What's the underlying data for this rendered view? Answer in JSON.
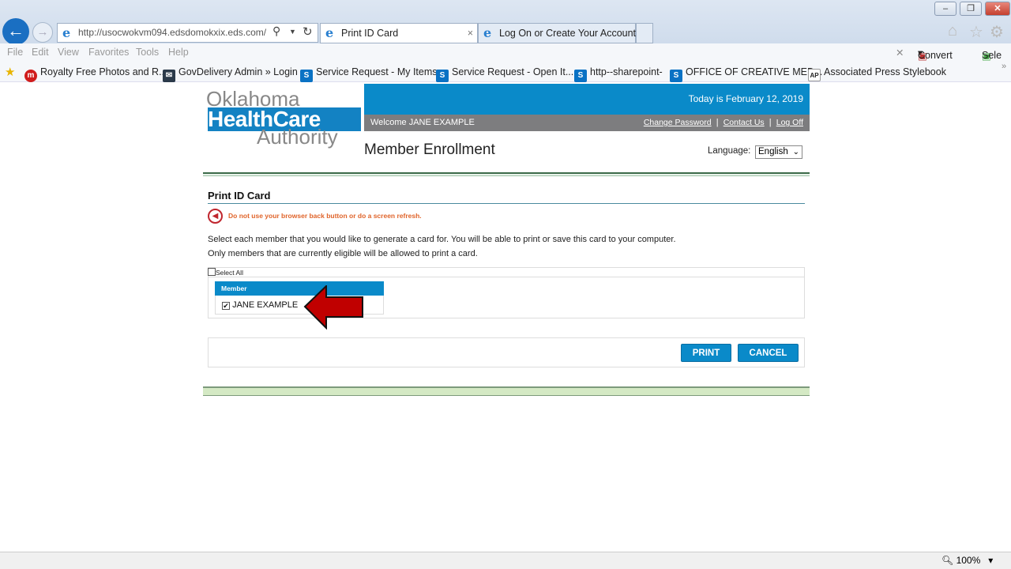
{
  "browser": {
    "address": "http://usocwokvm094.edsdomokxix.eds.com/",
    "tabs": [
      {
        "label": "Print ID Card",
        "active": true
      },
      {
        "label": "Log On or Create Your Account",
        "active": false
      }
    ],
    "menu": [
      "File",
      "Edit",
      "View",
      "Favorites",
      "Tools",
      "Help"
    ],
    "favorites": [
      "Royalty Free Photos and R...",
      "GovDelivery Admin » Login",
      "Service Request - My Items",
      "Service Request - Open It...",
      "http--sharepoint-",
      "OFFICE OF CREATIVE MED...",
      "Associated Press Stylebook"
    ],
    "convert_label": "Convert",
    "select_label": "Sele",
    "zoom": "100%"
  },
  "header": {
    "logo": {
      "line1": "Oklahoma",
      "line2": "HealthCare",
      "line3": "Authority"
    },
    "date": "Today is February 12, 2019",
    "welcome": "Welcome JANE EXAMPLE",
    "links": [
      "Change Password",
      "Contact Us",
      "Log Off"
    ],
    "title": "Member Enrollment",
    "language_label": "Language:",
    "language_value": "English"
  },
  "main": {
    "title": "Print ID Card",
    "warning": "Do not use your browser back button or do a screen refresh.",
    "instructions1": "Select each member that you would like to generate a card for. You will be able to print or save this card to your computer.",
    "instructions2": "Only members that are currently eligible will be allowed to print a card.",
    "select_all": "Select All",
    "select_all_checked": false,
    "member_header": "Member",
    "members": [
      {
        "name": "JANE EXAMPLE",
        "checked": true
      }
    ],
    "print_label": "PRINT",
    "cancel_label": "CANCEL"
  },
  "colors": {
    "brand_blue": "#0a8ac9",
    "header_gray": "#7d7d7f",
    "warning": "#e0642a",
    "arrow": "#c00000"
  }
}
